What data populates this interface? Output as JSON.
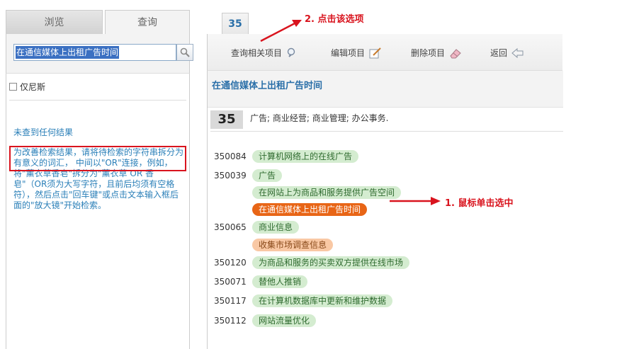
{
  "left_panel": {
    "tabs": [
      {
        "label": "浏览"
      },
      {
        "label": "查询"
      }
    ],
    "search": {
      "value": "在通信媒体上出租广告时间"
    },
    "filter_label": "仅尼斯",
    "no_result": "未查到任何结果",
    "hint": "为改善检索结果，请将待检索的字符串拆分为有意义的词汇， 中间以\"OR\"连接，例如，将\"薰衣草香皂\"拆分为\"薰衣草 OR 香皂\"（OR须为大写字符，且前后均须有空格符），然后点击\"回车键\"或点击文本输入框后面的\"放大镜\"开始检索。"
  },
  "right_panel": {
    "tab": "35",
    "toolbar": [
      {
        "label": "查询相关项目",
        "icon": "magnifier-icon"
      },
      {
        "label": "编辑项目",
        "icon": "edit-icon"
      },
      {
        "label": "删除项目",
        "icon": "eraser-icon"
      },
      {
        "label": "返回",
        "icon": "back-arrow-icon"
      }
    ],
    "heading": "在通信媒体上出租广告时间",
    "class_number": "35",
    "class_description": "广告; 商业经营; 商业管理; 办公事务.",
    "items": [
      {
        "code": "350084",
        "label": "计算机网络上的在线广告",
        "style": "green"
      },
      {
        "code": "350039",
        "label": "广告",
        "style": "green"
      },
      {
        "code": "",
        "label": "在网站上为商品和服务提供广告空间",
        "style": "green"
      },
      {
        "code": "",
        "label": "在通信媒体上出租广告时间",
        "style": "selected"
      },
      {
        "code": "350065",
        "label": "商业信息",
        "style": "green"
      },
      {
        "code": "",
        "label": "收集市场调查信息",
        "style": "orange"
      },
      {
        "code": "350120",
        "label": "为商品和服务的买卖双方提供在线市场",
        "style": "green"
      },
      {
        "code": "350071",
        "label": "替他人推销",
        "style": "green"
      },
      {
        "code": "350117",
        "label": "在计算机数据库中更新和维护数据",
        "style": "green"
      },
      {
        "code": "350112",
        "label": "网站流量优化",
        "style": "green"
      }
    ]
  },
  "annotations": {
    "step1": "1. 鼠标单击选中",
    "step2": "2. 点击该选项"
  },
  "colors": {
    "annotation_red": "#d9141e",
    "selected_orange": "#e86516",
    "pill_green": "#d4ecd0"
  }
}
